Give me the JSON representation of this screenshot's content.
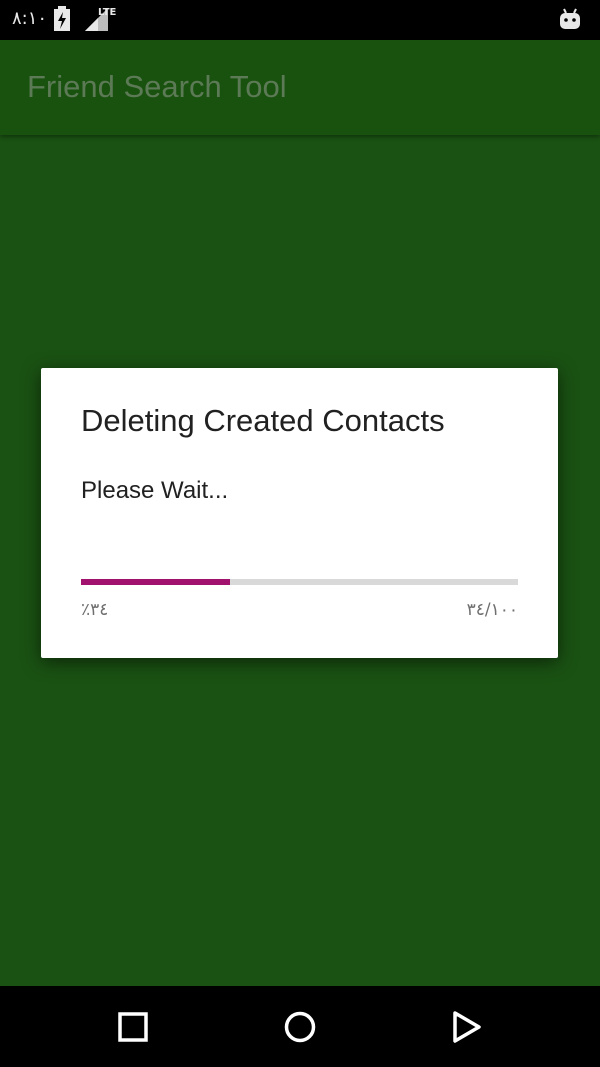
{
  "status_bar": {
    "time": "٨:١٠",
    "icons": [
      "flash-icon",
      "lte-signal-icon",
      "android-icon"
    ],
    "network_label": "LTE"
  },
  "app_bar": {
    "title": "Friend Search Tool"
  },
  "dialog": {
    "title": "Deleting Created Contacts",
    "message": "Please Wait...",
    "progress_fraction": 0.34,
    "percent_text": "٪٣٤",
    "count_text": "٣٤/١٠٠"
  },
  "nav_bar": {
    "icons": [
      "recents-icon",
      "home-icon",
      "back-icon"
    ]
  },
  "colors": {
    "status_bar_bg": "#000000",
    "app_bg_dimmed": "#1a5213",
    "progress_fill": "#a0126e",
    "progress_track": "#d9d9d9",
    "dialog_bg": "#ffffff"
  }
}
